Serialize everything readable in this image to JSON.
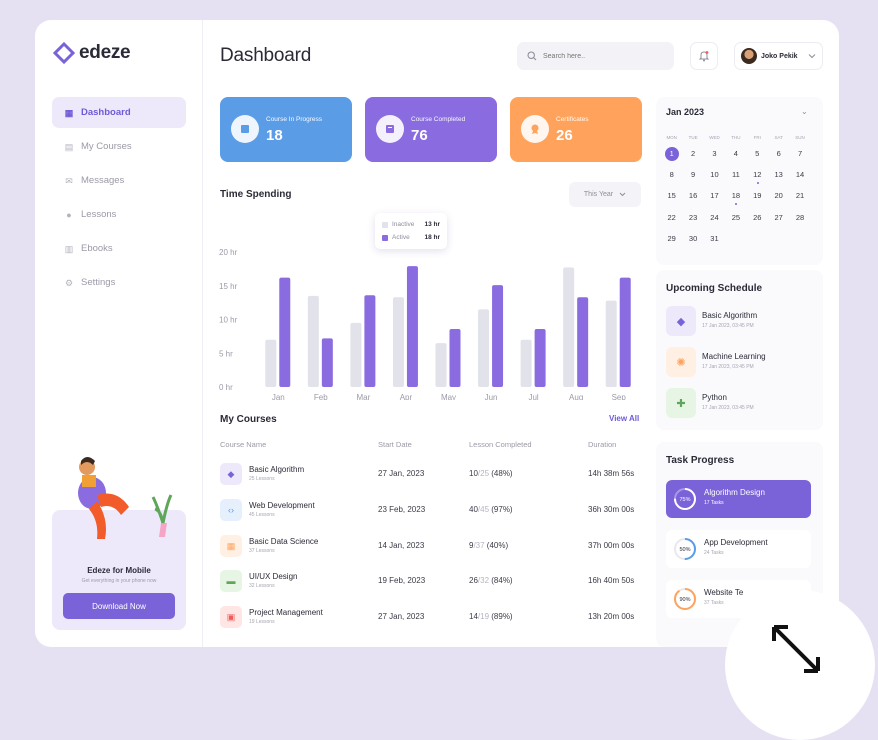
{
  "app": {
    "brand": "edeze",
    "page_title": "Dashboard"
  },
  "colors": {
    "accent": "#7a62d8",
    "blue": "#5a9de6",
    "orange": "#ffa35c",
    "inactive": "#e1e2ea"
  },
  "sidebar": {
    "items": [
      {
        "label": "Dashboard",
        "icon": "grid-icon",
        "active": true
      },
      {
        "label": "My Courses",
        "icon": "file-icon",
        "active": false
      },
      {
        "label": "Messages",
        "icon": "mail-icon",
        "active": false
      },
      {
        "label": "Lessons",
        "icon": "drop-icon",
        "active": false
      },
      {
        "label": "Ebooks",
        "icon": "book-icon",
        "active": false
      },
      {
        "label": "Settings",
        "icon": "gear-icon",
        "active": false
      }
    ],
    "promo": {
      "title": "Edeze for Mobile",
      "subtitle": "Get everything in your phone now",
      "button": "Download Now"
    }
  },
  "header": {
    "search_placeholder": "Search here..",
    "user_name": "Joko Pekik"
  },
  "stats": [
    {
      "label": "Course In Progress",
      "value": "18"
    },
    {
      "label": "Course Completed",
      "value": "76"
    },
    {
      "label": "Certificates",
      "value": "26"
    }
  ],
  "time_spending": {
    "title": "Time Spending",
    "filter": "This Year",
    "tooltip": {
      "inactive_label": "Inactive",
      "inactive_value": "13 hr",
      "active_label": "Active",
      "active_value": "18 hr"
    }
  },
  "chart_data": {
    "type": "bar",
    "categories": [
      "Jan",
      "Feb",
      "Mar",
      "Apr",
      "May",
      "Jun",
      "Jul",
      "Aug",
      "Sep"
    ],
    "series": [
      {
        "name": "Inactive",
        "values": [
          7,
          13.5,
          9.5,
          13.3,
          6.5,
          11.5,
          7,
          17.7,
          12.8
        ]
      },
      {
        "name": "Active",
        "values": [
          16.2,
          7.2,
          13.6,
          17.9,
          8.6,
          15.1,
          8.6,
          13.3,
          16.2
        ]
      }
    ],
    "ylim": [
      0,
      20
    ],
    "yticks": [
      "0 hr",
      "5 hr",
      "10 hr",
      "15 hr",
      "20 hr"
    ],
    "xlabel": "",
    "ylabel": ""
  },
  "courses": {
    "title": "My Courses",
    "view_all": "View All",
    "headers": [
      "Course Name",
      "Start Date",
      "Lesson Completed",
      "Duration"
    ],
    "rows": [
      {
        "name": "Basic Algorithm",
        "lessons": "25 Lessons",
        "date": "27 Jan, 2023",
        "done": "10",
        "total": "/25",
        "pct": " (48%)",
        "duration": "14h 38m 56s"
      },
      {
        "name": "Web Development",
        "lessons": "45 Lessons",
        "date": "23 Feb, 2023",
        "done": "40",
        "total": "/45",
        "pct": " (97%)",
        "duration": "36h 30m 00s"
      },
      {
        "name": "Basic Data Science",
        "lessons": "37 Lessons",
        "date": "14 Jan, 2023",
        "done": "9",
        "total": "/37",
        "pct": " (40%)",
        "duration": "37h 00m 00s"
      },
      {
        "name": "UI/UX Design",
        "lessons": "32 Lessons",
        "date": "19 Feb, 2023",
        "done": "26",
        "total": "/32",
        "pct": " (84%)",
        "duration": "16h 40m 50s"
      },
      {
        "name": "Project Management",
        "lessons": "19 Lessons",
        "date": "27 Jan, 2023",
        "done": "14",
        "total": "/19",
        "pct": " (89%)",
        "duration": "13h 20m 00s"
      }
    ]
  },
  "calendar": {
    "month": "Jan 2023",
    "weekdays": [
      "MON",
      "TUE",
      "WED",
      "THU",
      "FRI",
      "SAT",
      "SUN"
    ],
    "weeks": [
      [
        "1",
        "2",
        "3",
        "4",
        "5",
        "6",
        "7"
      ],
      [
        "8",
        "9",
        "10",
        "11",
        "12",
        "13",
        "14"
      ],
      [
        "15",
        "16",
        "17",
        "18",
        "19",
        "20",
        "21"
      ],
      [
        "22",
        "23",
        "24",
        "25",
        "26",
        "27",
        "28"
      ],
      [
        "29",
        "30",
        "31",
        "",
        "",
        "",
        ""
      ]
    ]
  },
  "schedule": {
    "title": "Upcoming Schedule",
    "items": [
      {
        "name": "Basic Algorithm",
        "time": "17 Jan 2023, 03:45 PM"
      },
      {
        "name": "Machine Learning",
        "time": "17 Jan 2023, 03:45 PM"
      },
      {
        "name": "Python",
        "time": "17 Jan 2023, 03:45 PM"
      }
    ]
  },
  "tasks": {
    "title": "Task Progress",
    "items": [
      {
        "name": "Algorithm Design",
        "sub": "17 Tasks",
        "pct": "75%",
        "value": 0.75
      },
      {
        "name": "App Development",
        "sub": "24 Tasks",
        "pct": "50%",
        "value": 0.5
      },
      {
        "name": "Website Te",
        "sub": "37 Tasks",
        "pct": "90%",
        "value": 0.9
      }
    ]
  }
}
